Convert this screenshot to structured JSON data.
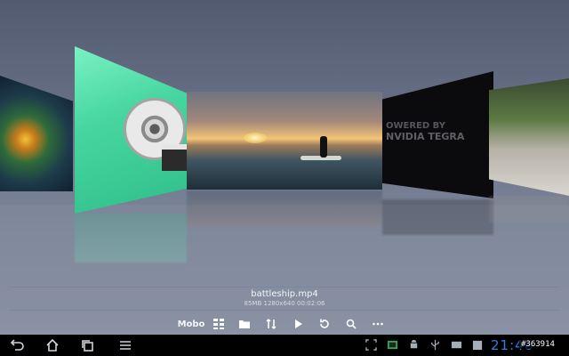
{
  "coverflow": {
    "cards": [
      {
        "name": "fantasy-scene-thumbnail"
      },
      {
        "name": "film-reel-thumbnail"
      },
      {
        "name": "sunset-surfer-thumbnail"
      },
      {
        "name": "nvidia-tegra-thumbnail"
      },
      {
        "name": "park-scene-thumbnail"
      }
    ],
    "powered_line1": "OWERED BY",
    "powered_line2": "NVIDIA TEGRA"
  },
  "file": {
    "name": "battleship.mp4",
    "meta": "85MB 1280x640 00:02:06"
  },
  "toolbar": {
    "brand": "Mobo",
    "icons": [
      "grid-view-icon",
      "folder-icon",
      "sort-icon",
      "play-icon",
      "refresh-icon",
      "search-icon",
      "more-icon"
    ]
  },
  "statusbar": {
    "clock": "21:46",
    "watermark": "#363914"
  },
  "colors": {
    "background": "#5a6378",
    "clock": "#2f7fd6",
    "accent_green": "#48d6a0"
  }
}
